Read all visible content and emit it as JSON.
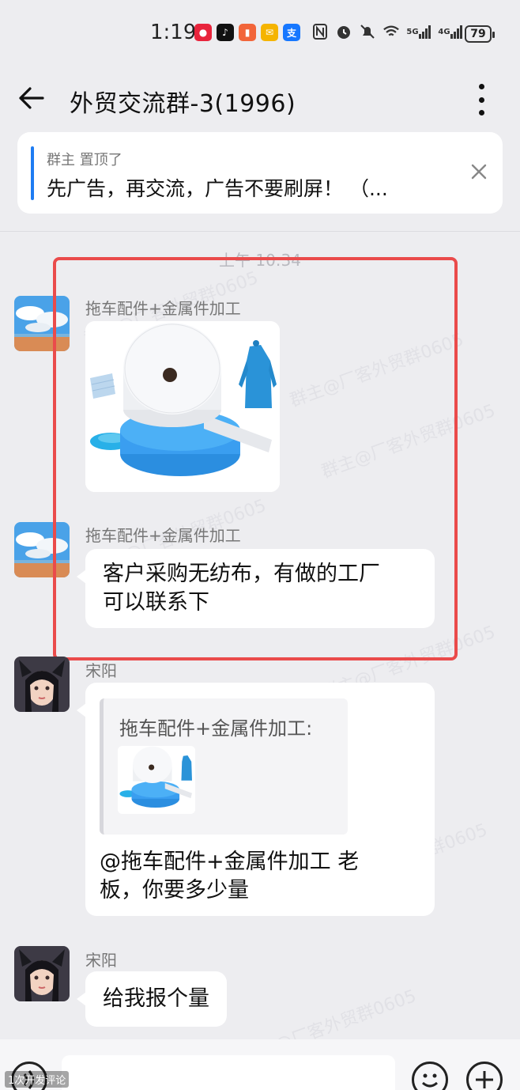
{
  "status_bar": {
    "time": "1:19",
    "network_5g": "5G",
    "network_4g": "4G",
    "battery": "79"
  },
  "header": {
    "title": "外贸交流群-3(1996)"
  },
  "pinned": {
    "meta": "群主 置顶了",
    "text": "先广告，再交流，广告不要刷屏！ （..."
  },
  "timestamp": "上午 10:34",
  "messages": [
    {
      "sender": "拖车配件+金属件加工",
      "type": "image"
    },
    {
      "sender": "拖车配件+金属件加工",
      "text_line1": "客户采购无纺布，有做的工厂",
      "text_line2": "可以联系下"
    },
    {
      "sender": "宋阳",
      "quote_sender": "拖车配件+金属件加工:",
      "text_line1": "@拖车配件+金属件加工  老",
      "text_line2": "板，你要多少量"
    },
    {
      "sender": "宋阳",
      "text": "给我报个量"
    }
  ],
  "watermark": "群主@厂客外贸群0605",
  "corner_mark": "1次开发评论",
  "colors": {
    "accent_blue": "#1e7cf2",
    "highlight_red": "#ea4b4b",
    "background": "#ededf0"
  }
}
